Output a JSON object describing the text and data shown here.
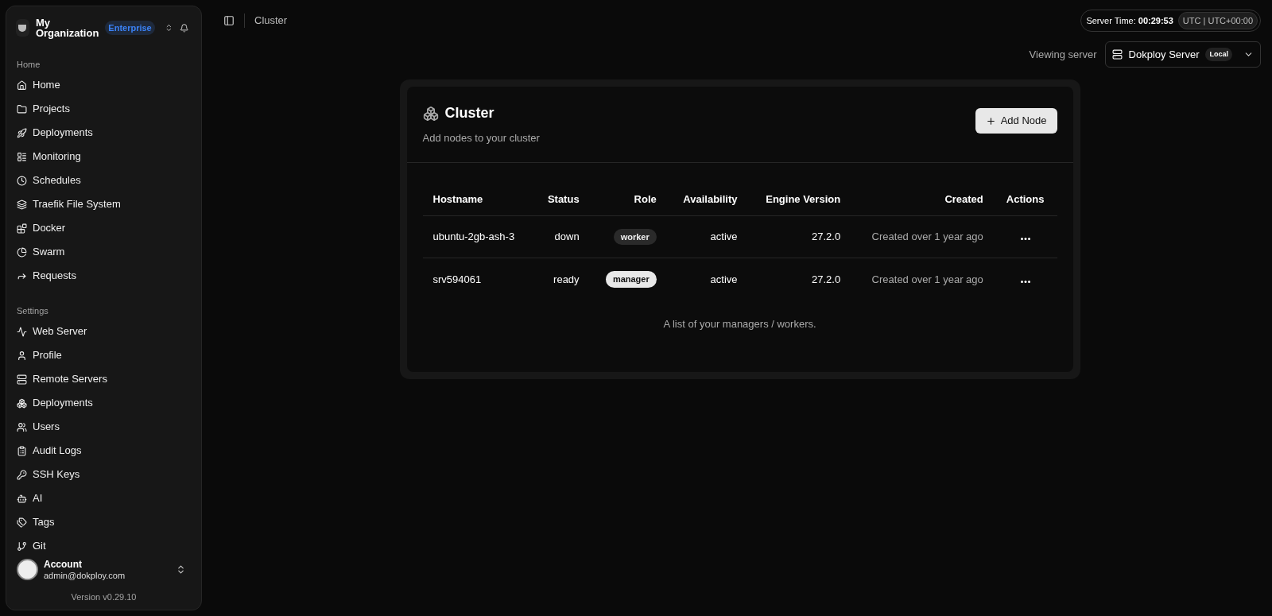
{
  "organization": {
    "name": "My Organization",
    "plan": "Enterprise"
  },
  "sidebar": {
    "sections": [
      {
        "title": "Home",
        "items": [
          {
            "label": "Home"
          },
          {
            "label": "Projects"
          },
          {
            "label": "Deployments"
          },
          {
            "label": "Monitoring"
          },
          {
            "label": "Schedules"
          },
          {
            "label": "Traefik File System"
          },
          {
            "label": "Docker"
          },
          {
            "label": "Swarm"
          },
          {
            "label": "Requests"
          }
        ]
      },
      {
        "title": "Settings",
        "items": [
          {
            "label": "Web Server"
          },
          {
            "label": "Profile"
          },
          {
            "label": "Remote Servers"
          },
          {
            "label": "Deployments"
          },
          {
            "label": "Users"
          },
          {
            "label": "Audit Logs"
          },
          {
            "label": "SSH Keys"
          },
          {
            "label": "AI"
          },
          {
            "label": "Tags"
          },
          {
            "label": "Git"
          }
        ]
      }
    ]
  },
  "account": {
    "name": "Account",
    "email": "admin@dokploy.com",
    "version": "Version v0.29.10"
  },
  "breadcrumb": "Cluster",
  "server_time": {
    "label": "Server Time:",
    "time": "00:29:53",
    "zone": "UTC | UTC+00:00"
  },
  "viewing_server": {
    "label": "Viewing server",
    "name": "Dokploy Server",
    "badge": "Local"
  },
  "card": {
    "title": "Cluster",
    "subtitle": "Add nodes to your cluster",
    "button": "Add Node",
    "table": {
      "columns": [
        "Hostname",
        "Status",
        "Role",
        "Availability",
        "Engine Version",
        "Created",
        "Actions"
      ],
      "rows": [
        {
          "hostname": "ubuntu-2gb-ash-3",
          "status": "down",
          "role": {
            "label": "worker",
            "kind": "secondary"
          },
          "availability": "active",
          "engine": "27.2.0",
          "created": "Created over 1 year ago"
        },
        {
          "hostname": "srv594061",
          "status": "ready",
          "role": {
            "label": "manager",
            "kind": "primary"
          },
          "availability": "active",
          "engine": "27.2.0",
          "created": "Created over 1 year ago"
        }
      ],
      "caption": "A list of your managers / workers."
    }
  }
}
